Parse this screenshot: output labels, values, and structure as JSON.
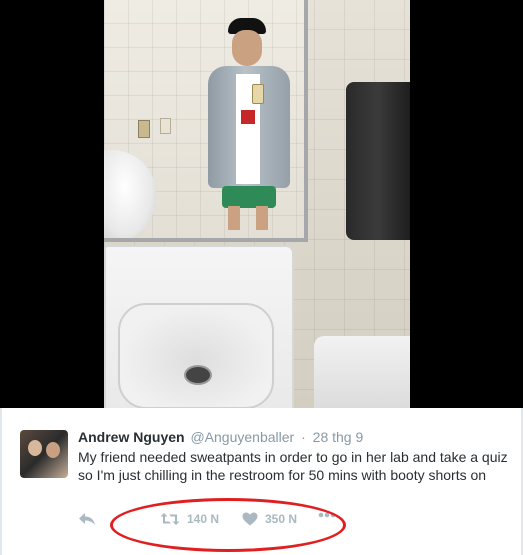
{
  "tweet": {
    "display_name": "Andrew Nguyen",
    "handle": "@Anguyenballer",
    "separator": "·",
    "date": "28 thg 9",
    "text": "My friend needed sweatpants in order to go in her lab and take a quiz so I'm just chilling in the restroom for 50 mins with booty shorts on"
  },
  "actions": {
    "reply_icon": "reply-icon",
    "retweet_icon": "retweet-icon",
    "retweet_count": "140 N",
    "like_icon": "heart-icon",
    "like_count": "350 N",
    "more_icon": "more-dots-icon"
  },
  "annotation": {
    "color": "#e02020"
  }
}
